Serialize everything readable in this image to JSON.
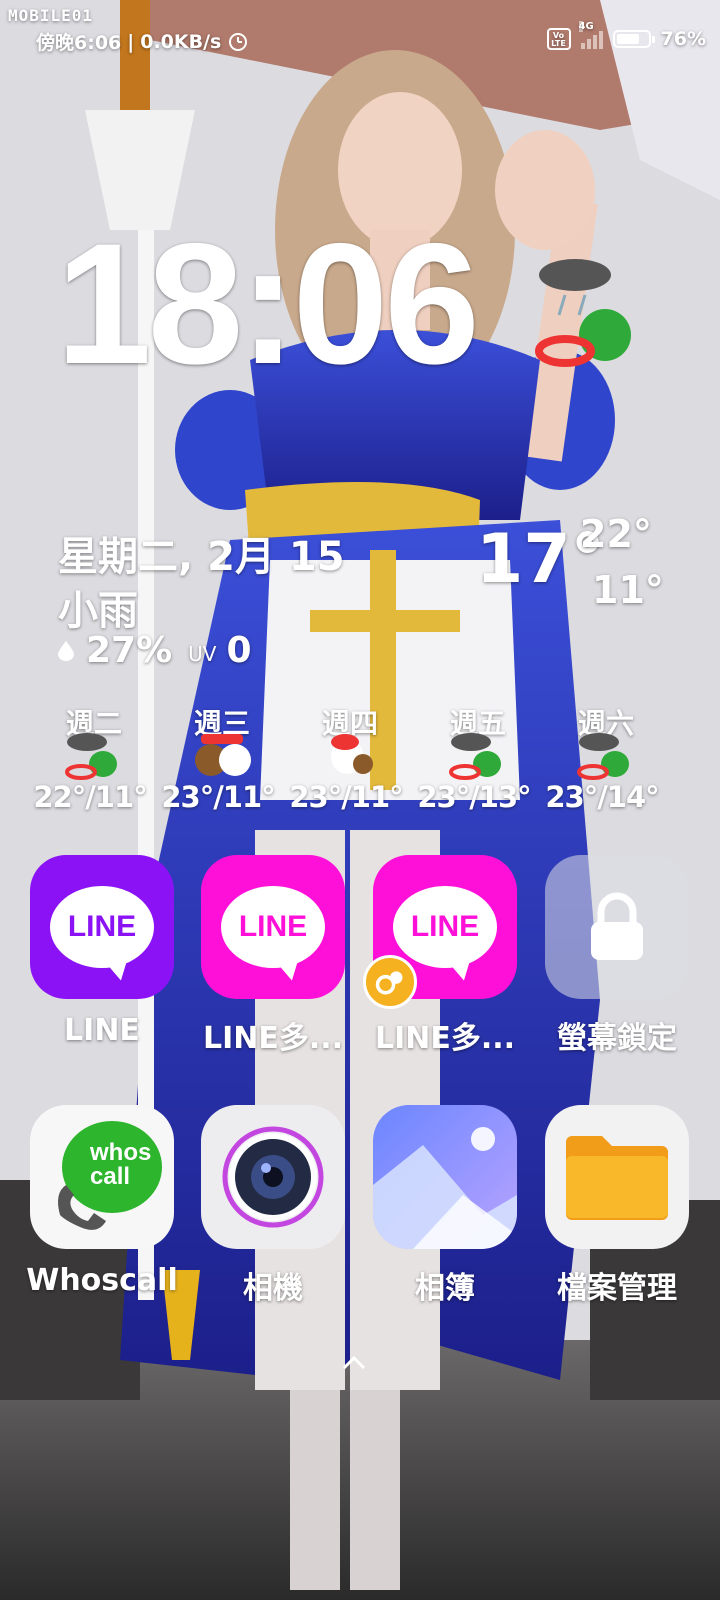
{
  "watermark": "MOBILE01",
  "status_bar": {
    "time": "傍晚6:06",
    "net_speed": "0.0KB/s",
    "volte": "Vo LTE",
    "network": "4G",
    "battery_level": 76,
    "battery_text": "76%"
  },
  "clock": {
    "time": "18:06"
  },
  "weather": {
    "date": "星期二, 2月 15",
    "condition": "小雨",
    "humidity": "27%",
    "uv_label": "UV",
    "uv_value": "0",
    "current_temp": "17°",
    "high": "22°",
    "low": "11°",
    "forecast": [
      {
        "day": "週二",
        "temp": "22°/11°",
        "icon": "rain-icon"
      },
      {
        "day": "週三",
        "temp": "23°/11°",
        "icon": "sticker-icon"
      },
      {
        "day": "週四",
        "temp": "23°/11°",
        "icon": "sun-icon"
      },
      {
        "day": "週五",
        "temp": "23°/13°",
        "icon": "rain-icon"
      },
      {
        "day": "週六",
        "temp": "23°/14°",
        "icon": "rain-icon"
      }
    ]
  },
  "apps": [
    {
      "label": "LINE",
      "icon_text": "LINE",
      "bg": "#8a12f5",
      "fg": "#8a12f5"
    },
    {
      "label": "LINE多...",
      "icon_text": "LINE",
      "bg": "#ff10d8",
      "fg": "#ff10d8"
    },
    {
      "label": "LINE多...",
      "icon_text": "LINE",
      "bg": "#ff10d8",
      "fg": "#ff10d8"
    },
    {
      "label": "螢幕鎖定",
      "icon": "lock-icon"
    }
  ],
  "dock": [
    {
      "label": "Whoscall",
      "icon_text": "whos call",
      "icon": "whoscall-icon"
    },
    {
      "label": "相機",
      "icon": "camera-icon"
    },
    {
      "label": "相簿",
      "icon": "gallery-icon"
    },
    {
      "label": "檔案管理",
      "icon": "folder-icon"
    }
  ],
  "colors": {
    "line_purple": "#8a12f5",
    "line_pink": "#ff10d8",
    "whoscall_green": "#2db52d",
    "folder_yellow": "#f9b82a"
  }
}
